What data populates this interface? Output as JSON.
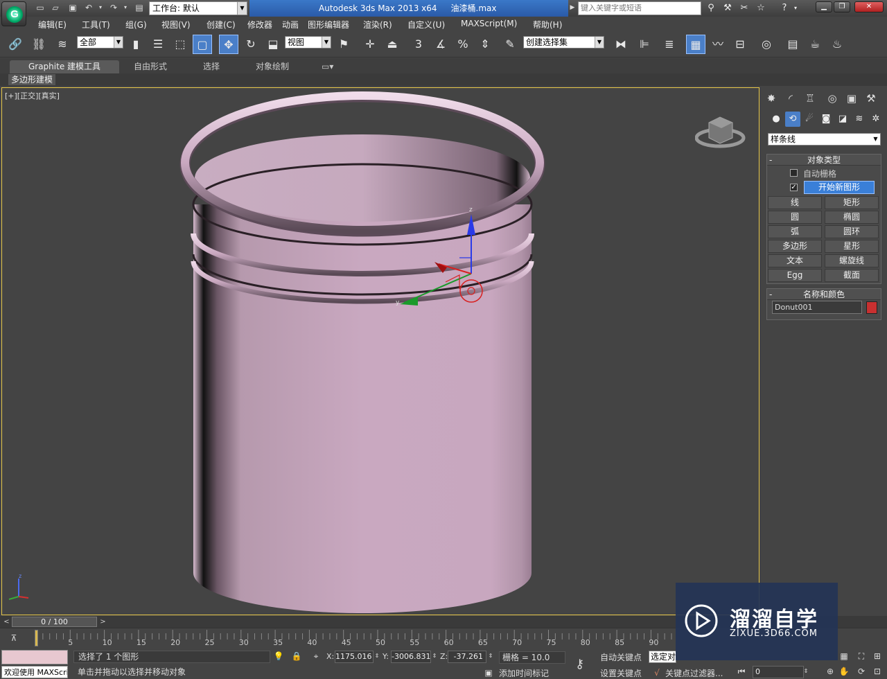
{
  "title_bar": {
    "workspace_label": "工作台: 默认",
    "app_name": "Autodesk 3ds Max  2013 x64",
    "file_name": "油漆桶.max",
    "search_placeholder": "键入关键字或短语"
  },
  "menu": [
    "编辑(E)",
    "工具(T)",
    "组(G)",
    "视图(V)",
    "创建(C)",
    "修改器",
    "动画",
    "图形编辑器",
    "渲染(R)",
    "自定义(U)",
    "MAXScript(M)",
    "帮助(H)"
  ],
  "toolbar": {
    "selection_filter": "全部",
    "ref_coord": "视图",
    "snap_angle": "3",
    "named_selection": "创建选择集"
  },
  "ribbon": {
    "tabs": [
      "Graphite 建模工具",
      "自由形式",
      "选择",
      "对象绘制"
    ],
    "sub_label": "多边形建模"
  },
  "viewport": {
    "label": "[+][正交][真实]",
    "object_color": "#c9a8c0"
  },
  "command_panel": {
    "category": "样条线",
    "object_type_title": "对象类型",
    "auto_grid": "自动栅格",
    "start_new_shape": "开始新图形",
    "start_new_shape_checked": true,
    "buttons": [
      "线",
      "矩形",
      "圆",
      "椭圆",
      "弧",
      "圆环",
      "多边形",
      "星形",
      "文本",
      "螺旋线",
      "Egg",
      "截面"
    ],
    "name_color_title": "名称和颜色",
    "object_name": "Donut001",
    "object_color": "#c83030"
  },
  "timeline": {
    "frame_display": "0 / 100",
    "ticks": [
      "5",
      "10",
      "15",
      "20",
      "25",
      "30",
      "35",
      "40",
      "45",
      "50",
      "55",
      "60",
      "65",
      "70",
      "75",
      "80",
      "85",
      "90"
    ]
  },
  "status": {
    "script_label": "欢迎使用 MAXScri",
    "selection": "选择了 1 个图形",
    "prompt": "单击并拖动以选择并移动对象",
    "x_label": "X:",
    "x": "1175.016",
    "y_label": "Y:",
    "y": "-3006.831",
    "z_label": "Z:",
    "z": "-37.261",
    "grid": "栅格 = 10.0",
    "add_time_tag": "添加时间标记",
    "auto_key": "自动关键点",
    "set_key": "设置关键点",
    "selected_set": "选定对",
    "key_filter": "关键点过滤器...",
    "current_frame": "0"
  },
  "watermark": {
    "title": "溜溜自学",
    "url": "ZIXUE.3D66.COM"
  }
}
